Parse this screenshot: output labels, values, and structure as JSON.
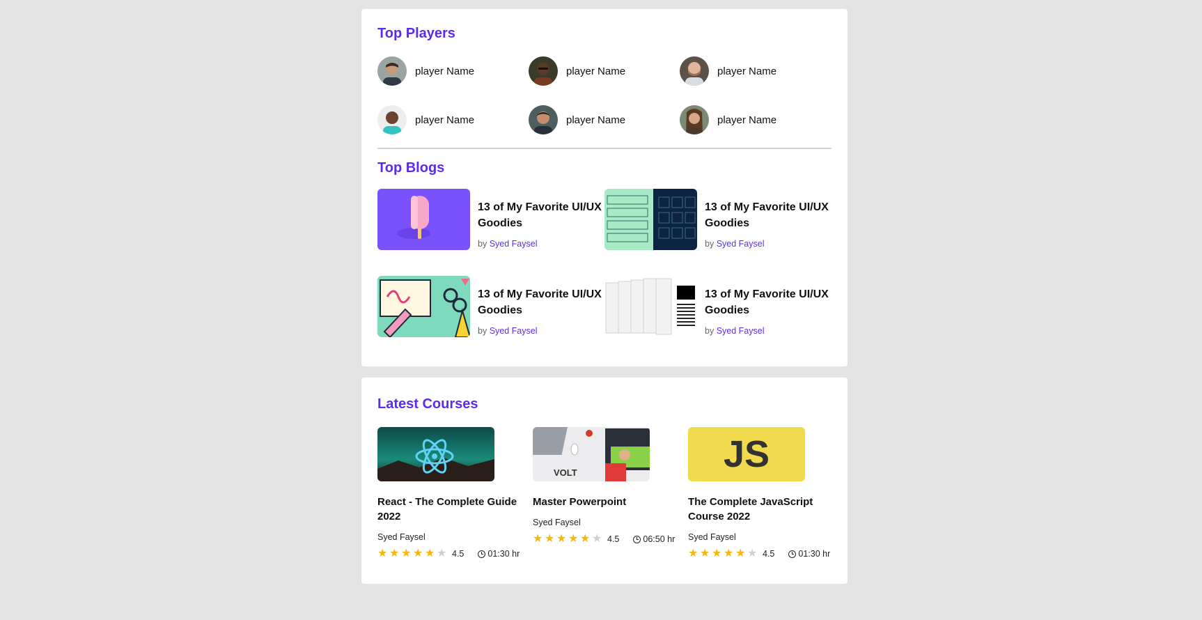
{
  "top_players": {
    "title": "Top Players",
    "players": [
      {
        "name": "player Name",
        "avatar": "avatar-icon"
      },
      {
        "name": "player Name",
        "avatar": "avatar-icon"
      },
      {
        "name": "player Name",
        "avatar": "avatar-icon"
      },
      {
        "name": "player Name",
        "avatar": "avatar-icon"
      },
      {
        "name": "player Name",
        "avatar": "avatar-icon"
      },
      {
        "name": "player Name",
        "avatar": "avatar-icon"
      }
    ]
  },
  "top_blogs": {
    "title": "Top Blogs",
    "blogs": [
      {
        "title": "13 of My Favorite UI/UX Goodies",
        "by": "by",
        "author": "Syed Faysel"
      },
      {
        "title": "13 of My Favorite UI/UX Goodies",
        "by": "by",
        "author": "Syed Faysel"
      },
      {
        "title": "13 of My Favorite UI/UX Goodies",
        "by": "by",
        "author": "Syed Faysel"
      },
      {
        "title": "13 of My Favorite UI/UX Goodies",
        "by": "by",
        "author": "Syed Faysel"
      }
    ]
  },
  "latest_courses": {
    "title": "Latest Courses",
    "courses": [
      {
        "title": "React - The Complete Guide 2022",
        "author": "Syed Faysel",
        "rating": "4.5",
        "rating_value": 4.5,
        "duration": "01:30 hr"
      },
      {
        "title": "Master Powerpoint",
        "author": "Syed Faysel",
        "rating": "4.5",
        "rating_value": 4.5,
        "duration": "06:50 hr",
        "thumb_text": "VOLT"
      },
      {
        "title": "The Complete JavaScript Course 2022",
        "author": "Syed Faysel",
        "rating": "4.5",
        "rating_value": 4.5,
        "duration": "01:30 hr",
        "thumb_text": "JS"
      }
    ]
  },
  "colors": {
    "accent": "#5b2bf0",
    "star": "#f5b70c",
    "background": "#e4e4e4"
  }
}
